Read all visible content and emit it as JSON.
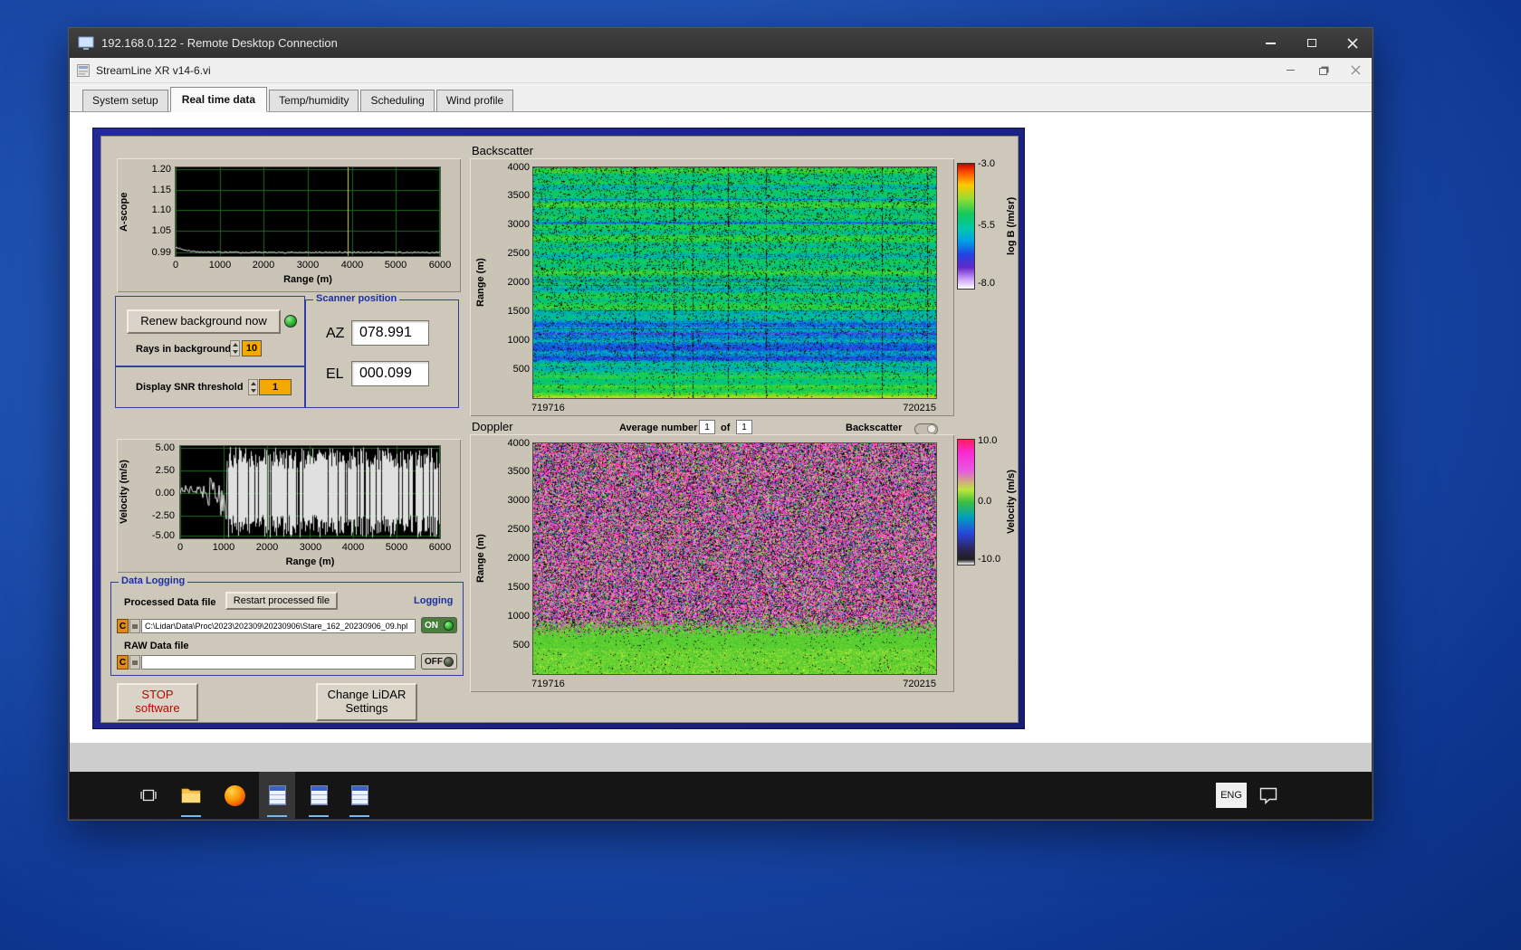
{
  "rdp": {
    "title": "192.168.0.122 - Remote Desktop Connection"
  },
  "app": {
    "title": "StreamLine XR v14-6.vi",
    "tabs": [
      {
        "label": "System setup"
      },
      {
        "label": "Real time data"
      },
      {
        "label": "Temp/humidity"
      },
      {
        "label": "Scheduling"
      },
      {
        "label": "Wind profile"
      }
    ]
  },
  "ascope": {
    "ylabel": "A-scope",
    "xlabel": "Range (m)",
    "yticks": [
      "1.20",
      "1.15",
      "1.10",
      "1.05",
      "0.99"
    ],
    "xticks": [
      "0",
      "1000",
      "2000",
      "3000",
      "4000",
      "5000",
      "6000"
    ]
  },
  "background_controls": {
    "renew_button": "Renew background now",
    "rays_label": "Rays in background",
    "rays_value": "10",
    "snr_label": "Display SNR threshold",
    "snr_value": "1"
  },
  "scanner": {
    "title": "Scanner position",
    "az_label": "AZ",
    "az_value": "078.991",
    "el_label": "EL",
    "el_value": "000.099"
  },
  "backscatter": {
    "title": "Backscatter",
    "ylabel": "Range (m)",
    "yticks": [
      "4000",
      "3500",
      "3000",
      "2500",
      "2000",
      "1500",
      "1000",
      "500"
    ],
    "x_start": "719716",
    "x_end": "720215",
    "colorbar_label": "log B (/m/sr)",
    "colorbar_ticks": [
      "-3.0",
      "-5.5",
      "-8.0"
    ]
  },
  "doppler": {
    "title": "Doppler",
    "average_label": "Average number",
    "average_value": "1",
    "of_label": "of",
    "of_count": "1",
    "backscatter_toggle_label": "Backscatter",
    "ylabel": "Range (m)",
    "yticks": [
      "4000",
      "3500",
      "3000",
      "2500",
      "2000",
      "1500",
      "1000",
      "500"
    ],
    "x_start": "719716",
    "x_end": "720215",
    "colorbar_label": "Velocity (m/s)",
    "colorbar_ticks": [
      "10.0",
      "0.0",
      "-10.0"
    ]
  },
  "velocity": {
    "ylabel": "Velocity (m/s)",
    "xlabel": "Range (m)",
    "yticks": [
      "5.00",
      "2.50",
      "0.00",
      "-2.50",
      "-5.00"
    ],
    "xticks": [
      "0",
      "1000",
      "2000",
      "3000",
      "4000",
      "5000",
      "6000"
    ]
  },
  "logging": {
    "title": "Data Logging",
    "processed_label": "Processed Data file",
    "restart_button": "Restart processed file",
    "logging_label": "Logging",
    "drive": "C",
    "processed_path": "C:\\Lidar\\Data\\Proc\\2023\\202309\\20230906\\Stare_162_20230906_09.hpl",
    "on_label": "ON",
    "raw_label": "RAW Data file",
    "raw_path": "",
    "off_label": "OFF"
  },
  "footer": {
    "stop_line1": "STOP",
    "stop_line2": "software",
    "change_line1": "Change LiDAR",
    "change_line2": "Settings"
  },
  "taskbar": {
    "language": "ENG"
  },
  "colors": {
    "accent_blue": "#2c3fa6",
    "value_field_amber": "#f5a800",
    "led_on_green": "#33cc33",
    "stop_red": "#c40000",
    "panel_tan": "#cec8bb",
    "panel_navy": "#1b1f86"
  },
  "chart_data": [
    {
      "type": "line",
      "title": "A-scope",
      "xlabel": "Range (m)",
      "ylabel": "A-scope",
      "xlim": [
        0,
        6000
      ],
      "ylim": [
        0.99,
        1.2
      ],
      "description": "Flat white trace near 0.99 with small bump at 0 m and yellow cursor near 3900 m",
      "grid": true
    },
    {
      "type": "heatmap",
      "title": "Backscatter",
      "ylabel": "Range (m)",
      "ylim": [
        0,
        4000
      ],
      "x_range": [
        "719716",
        "720215"
      ],
      "colorbar": {
        "label": "log B (/m/sr)",
        "max": -3.0,
        "mid": -5.5,
        "min": -8.0
      },
      "description": "Green/teal speckle above 1500 m, bluer band 500-1500 m, bright green below 500 m"
    },
    {
      "type": "line",
      "title": "Velocity",
      "xlabel": "Range (m)",
      "ylabel": "Velocity (m/s)",
      "xlim": [
        0,
        6000
      ],
      "ylim": [
        -5,
        5
      ],
      "description": "Quiet trace below ~1000 m then saturated noise spanning full scale",
      "grid": true
    },
    {
      "type": "heatmap",
      "title": "Doppler",
      "ylabel": "Range (m)",
      "ylim": [
        0,
        4000
      ],
      "x_range": [
        "719716",
        "720215"
      ],
      "colorbar": {
        "label": "Velocity (m/s)",
        "max": 10.0,
        "mid": 0.0,
        "min": -10.0
      },
      "description": "Magenta/black noise above ~800 m, green low-velocity band below ~700 m"
    }
  ]
}
